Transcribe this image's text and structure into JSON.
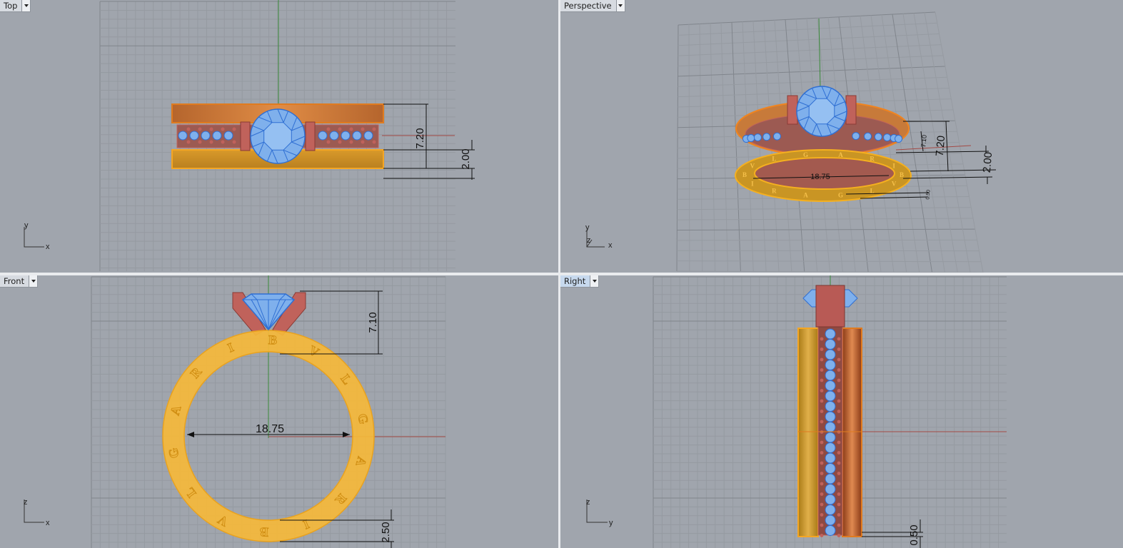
{
  "viewports": {
    "top": {
      "label": "Top"
    },
    "persp": {
      "label": "Perspective"
    },
    "front": {
      "label": "Front"
    },
    "right": {
      "label": "Right"
    }
  },
  "dimensions": {
    "top_height": "7.20",
    "top_band": "2.00",
    "persp_height": "7.20",
    "persp_band": "2.00",
    "persp_small": "7.10",
    "persp_diam": "18.75",
    "persp_tiny": "0.50",
    "front_setting": "7.10",
    "front_diameter": "18.75",
    "front_band": "2.50",
    "right_band": "0.50"
  },
  "axes": {
    "x": "x",
    "y": "y",
    "z": "z"
  },
  "ring_letters": [
    "B",
    "V",
    "L",
    "G",
    "A",
    "R",
    "I",
    "B",
    "V",
    "L",
    "G",
    "A",
    "R",
    "I"
  ],
  "colors": {
    "background": "#a0a5ad",
    "grid": "#8a8f96",
    "gold": "#f2b33a",
    "gold_dark": "#c8931c",
    "copper": "#c77a3a",
    "prong": "#c0625b",
    "gem": "#7fb0ec",
    "gem_edge": "#2f6fd3",
    "axis_red": "#a34a45",
    "axis_green": "#3a8a3a"
  }
}
